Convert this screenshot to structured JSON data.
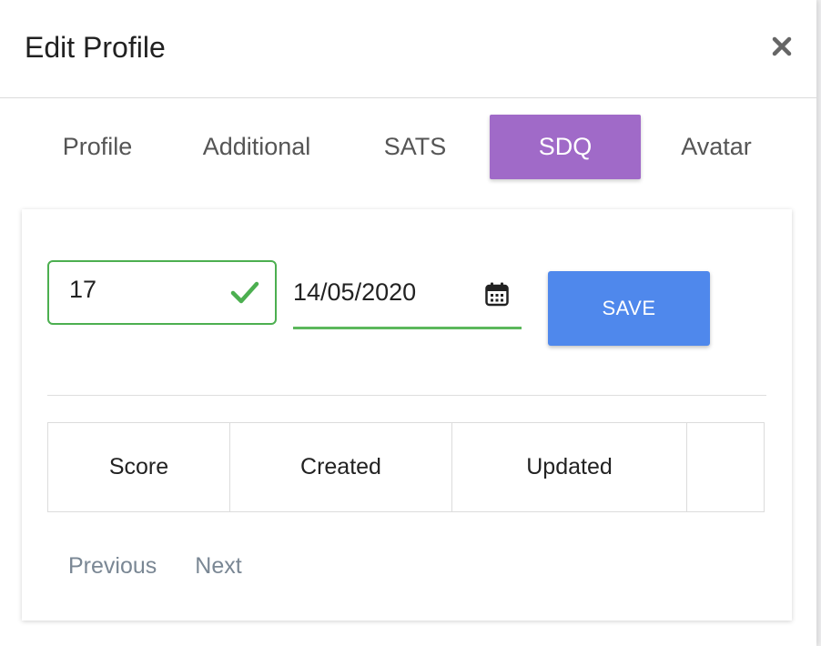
{
  "modal": {
    "title": "Edit Profile"
  },
  "tabs": [
    {
      "label": "Profile",
      "active": false
    },
    {
      "label": "Additional",
      "active": false
    },
    {
      "label": "SATS",
      "active": false
    },
    {
      "label": "SDQ",
      "active": true
    },
    {
      "label": "Avatar",
      "active": false
    }
  ],
  "form": {
    "score_value": "17",
    "date_value": "14/05/2020",
    "save_label": "SAVE"
  },
  "table": {
    "headers": [
      "Score",
      "Created",
      "Updated",
      ""
    ]
  },
  "pagination": {
    "previous_label": "Previous",
    "next_label": "Next"
  },
  "icons": {
    "close": "close-icon",
    "valid": "check-icon",
    "calendar": "calendar-icon"
  },
  "colors": {
    "active_tab": "#a06ac8",
    "save_button": "#4f88ec",
    "valid_green": "#4caf50"
  }
}
